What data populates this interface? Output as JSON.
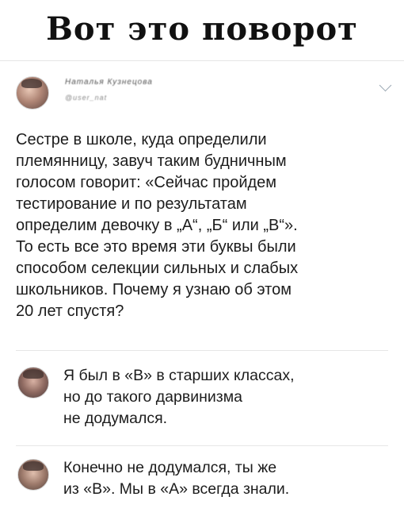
{
  "caption": "Вот это поворот",
  "post": {
    "author_name": "Наталья Кузнецова",
    "author_handle": "@user_nat",
    "text_lines": [
      "Сестре в школе, куда определили",
      "племянницу, завуч таким будничным",
      "голосом говорит: «Сейчас пройдем",
      "тестирование и по результатам",
      "определим девочку в „А“, „Б“ или „В“».",
      "То есть все это время эти буквы были",
      "способом селекции сильных и слабых",
      "школьников. Почему я узнаю об этом",
      "20 лет спустя?"
    ]
  },
  "replies": [
    {
      "text_lines": [
        "Я был в «В» в старших классах,",
        "но до такого дарвинизма",
        "не додумался."
      ]
    },
    {
      "text_lines": [
        "Конечно не додумался, ты же",
        "из «В». Мы в «А» всегда знали."
      ]
    }
  ]
}
